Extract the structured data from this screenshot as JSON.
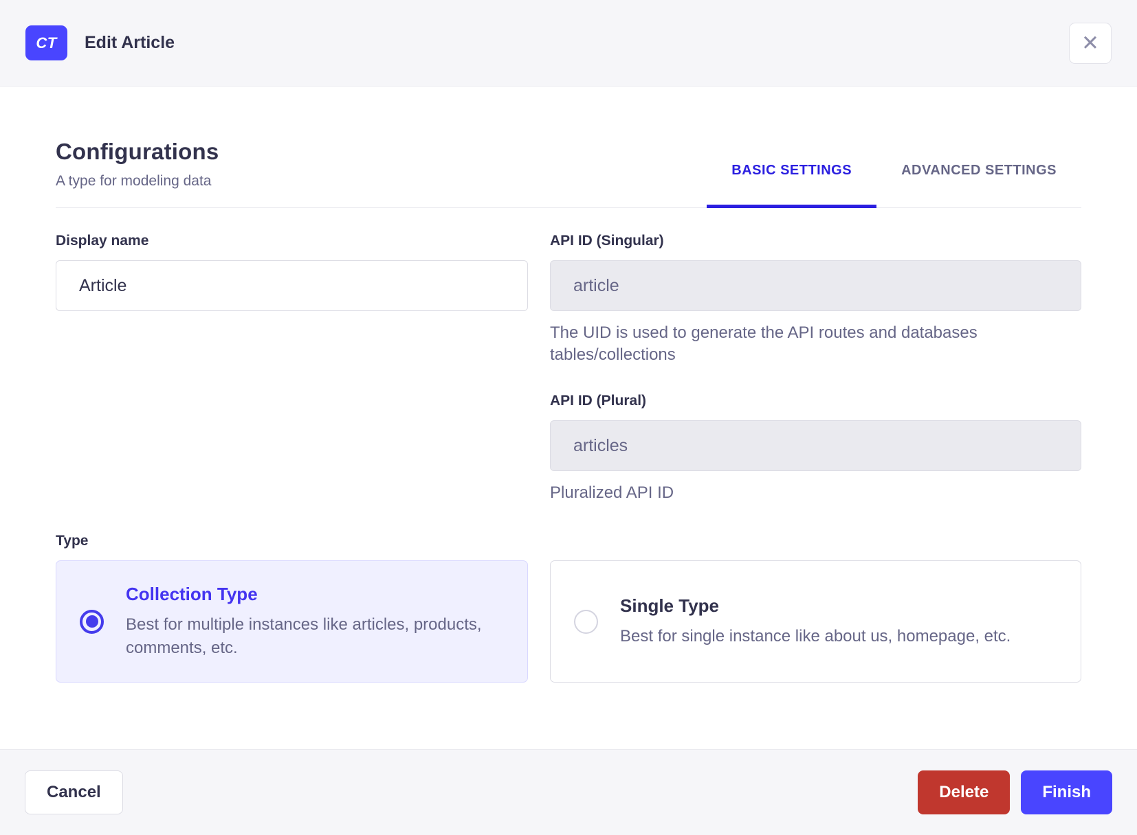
{
  "header": {
    "badge": "CT",
    "title": "Edit Article"
  },
  "icons": {
    "close": "✕"
  },
  "section": {
    "title": "Configurations",
    "subtitle": "A type for modeling data",
    "tabs": [
      {
        "label": "BASIC SETTINGS",
        "active": true
      },
      {
        "label": "ADVANCED SETTINGS",
        "active": false
      }
    ]
  },
  "form": {
    "display_name": {
      "label": "Display name",
      "value": "Article"
    },
    "api_id_singular": {
      "label": "API ID (Singular)",
      "value": "article",
      "hint": "The UID is used to generate the API routes and databases tables/collections"
    },
    "api_id_plural": {
      "label": "API ID (Plural)",
      "value": "articles",
      "hint": "Pluralized API ID"
    },
    "type": {
      "label": "Type",
      "options": [
        {
          "title": "Collection Type",
          "description": "Best for multiple instances like articles, products, comments, etc.",
          "selected": true
        },
        {
          "title": "Single Type",
          "description": "Best for single instance like about us, homepage, etc.",
          "selected": false
        }
      ]
    }
  },
  "footer": {
    "cancel": "Cancel",
    "delete": "Delete",
    "finish": "Finish"
  },
  "colors": {
    "primary": "#4945ff",
    "tab_active": "#2b1fe0",
    "danger": "#c0372e",
    "header_bg": "#f6f6f9",
    "text_dark": "#32324d",
    "text_muted": "#666687",
    "selected_card_bg": "#f0f0ff",
    "disabled_input_bg": "#eaeaef",
    "border": "#dcdce4"
  }
}
